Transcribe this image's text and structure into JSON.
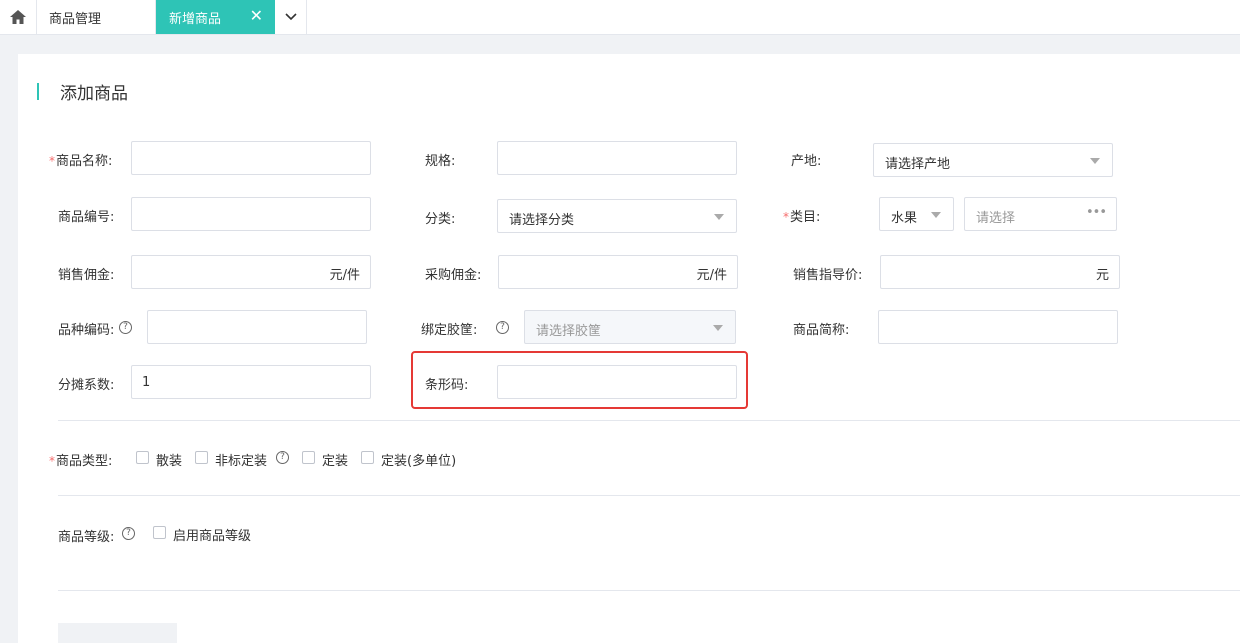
{
  "tabs": {
    "goods_label": "商品管理",
    "new_label": "新增商品",
    "close_symbol": "✕",
    "active_color": "#2ec4b6"
  },
  "page": {
    "title": "添加商品"
  },
  "form": {
    "name": {
      "label": "商品名称:",
      "value": ""
    },
    "spec": {
      "label": "规格:",
      "value": ""
    },
    "origin": {
      "label": "产地:",
      "value": "请选择产地"
    },
    "code": {
      "label": "商品编号:",
      "value": ""
    },
    "category": {
      "label": "分类:",
      "value": "请选择分类"
    },
    "class": {
      "label": "类目:",
      "value": "水果",
      "sub_placeholder": "请选择",
      "more": "•••"
    },
    "sales_commission": {
      "label": "销售佣金:",
      "value": "",
      "unit": "元/件"
    },
    "purchase_commission": {
      "label": "采购佣金:",
      "value": "",
      "unit": "元/件"
    },
    "guide_price": {
      "label": "销售指导价:",
      "value": "",
      "unit": "元"
    },
    "variety_code": {
      "label": "品种编码:",
      "value": ""
    },
    "basket": {
      "label": "绑定胶筐:",
      "value": "请选择胶筐"
    },
    "short_name": {
      "label": "商品简称:",
      "value": ""
    },
    "share_ratio": {
      "label": "分摊系数:",
      "value": "1"
    },
    "barcode": {
      "label": "条形码:",
      "value": ""
    },
    "required_mark": "*",
    "help_symbol": "?"
  },
  "product_type": {
    "label": "商品类型:",
    "options": [
      "散装",
      "非标定装",
      "定装",
      "定装(多单位)"
    ]
  },
  "product_grade": {
    "label": "商品等级:",
    "option": "启用商品等级"
  },
  "highlight_color": "#e53935"
}
